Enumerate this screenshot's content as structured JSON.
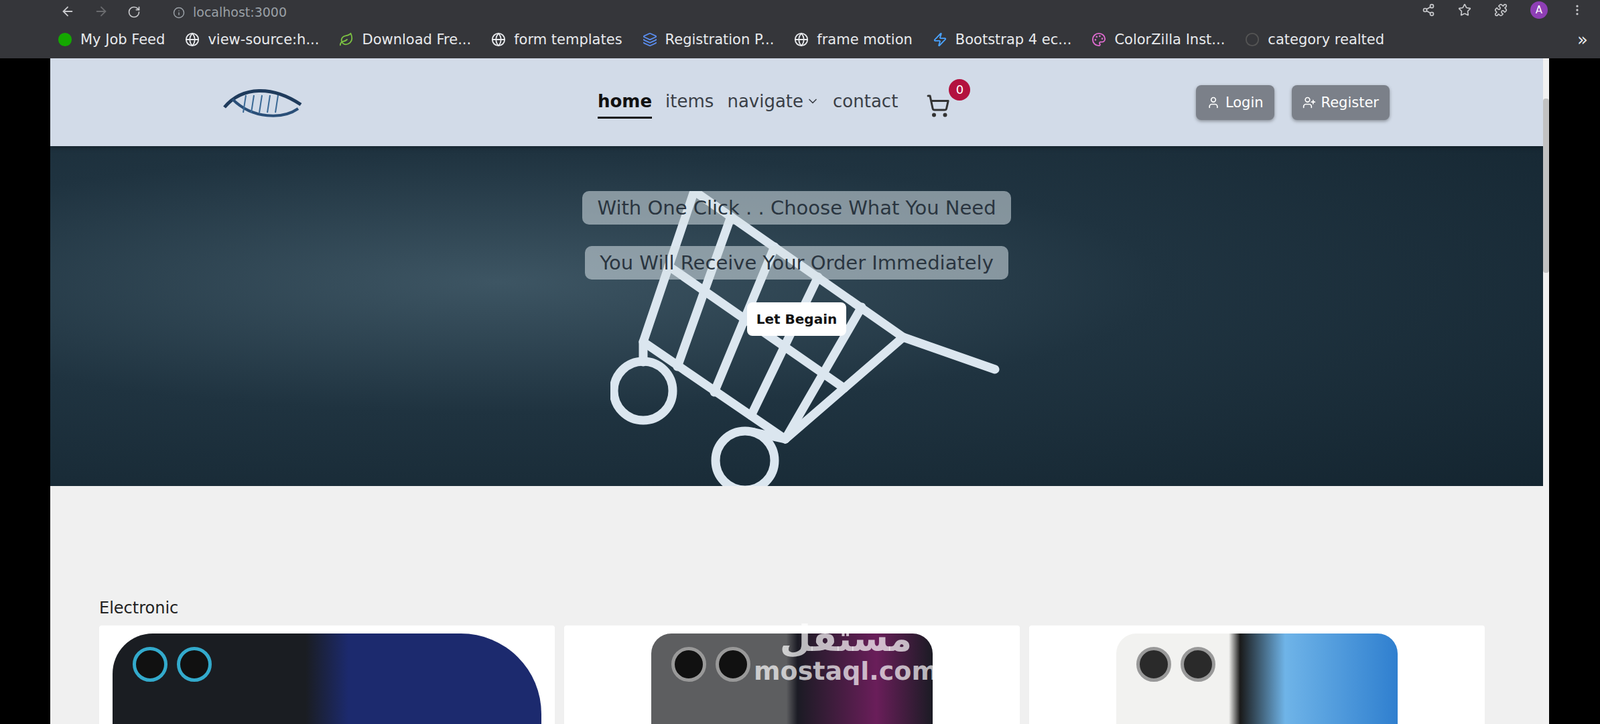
{
  "browser": {
    "address": "localhost:3000",
    "profile": "A",
    "bookmarks": [
      "My Job Feed",
      "view-source:h...",
      "Download Fre...",
      "form templates",
      "Registration P...",
      "frame motion",
      "Bootstrap 4 ec...",
      "ColorZilla Inst...",
      "category realted"
    ],
    "more": "»"
  },
  "nav": {
    "links": [
      {
        "label": "home",
        "selected": true,
        "dropdown": false
      },
      {
        "label": "items",
        "selected": false,
        "dropdown": false
      },
      {
        "label": "navigate",
        "selected": false,
        "dropdown": true
      },
      {
        "label": "contact",
        "selected": false,
        "dropdown": false
      }
    ],
    "cart_count": "0",
    "buttons": [
      "Login",
      "Register"
    ]
  },
  "hero": {
    "lines": [
      "With One Click . . Choose What You Need",
      "You Will Receive Your Order Immediately"
    ],
    "button": "Let Begain"
  },
  "section": {
    "title": "Electronic",
    "products": [
      {
        "kind": "watch"
      },
      {
        "kind": "dark-phone"
      },
      {
        "kind": "light-phone"
      }
    ]
  },
  "watermark": {
    "arabic": "مستقل",
    "latin": "mostaql.com"
  }
}
